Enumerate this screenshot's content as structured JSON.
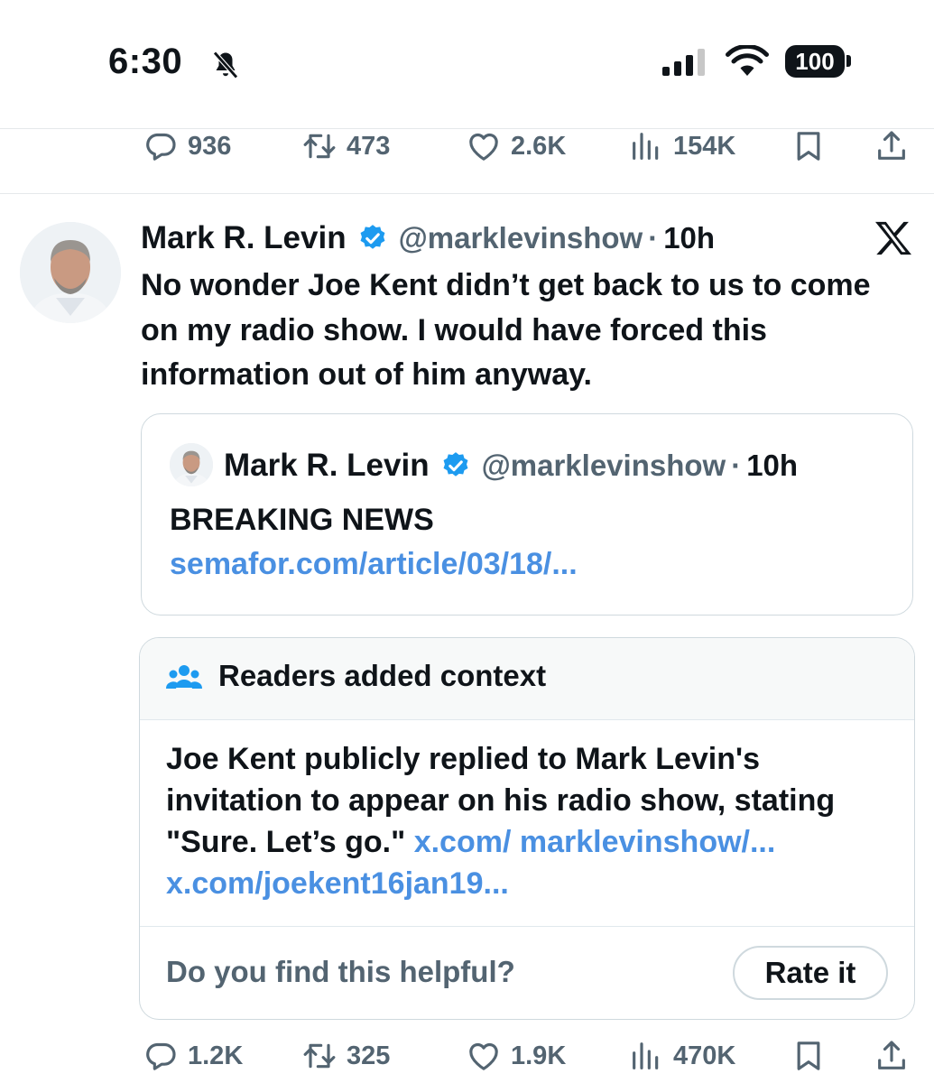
{
  "status_bar": {
    "time": "6:30",
    "battery": "100"
  },
  "prev_tweet_actions": {
    "replies": "936",
    "reposts": "473",
    "likes": "2.6K",
    "views": "154K"
  },
  "tweet": {
    "author_name": "Mark R. Levin",
    "handle": "@marklevinshow",
    "time_sep": "·",
    "age": "10h",
    "text": "No wonder Joe Kent didn’t get back to us to come on my radio show.  I would have forced this information out of him anyway."
  },
  "quoted_tweet": {
    "author_name": "Mark R. Levin",
    "handle": "@marklevinshow",
    "time_sep": "·",
    "age": "10h",
    "title": "BREAKING NEWS",
    "link": "semafor.com/article/03/18/..."
  },
  "community_note": {
    "title": "Readers added context",
    "text": "Joe Kent publicly replied to Mark Levin's invitation to appear on his radio show, stating \"Sure. Let’s go.\"",
    "link1_a": "x.com/",
    "link1_b": "marklevinshow/...",
    "link2": "x.com/joekent16jan19...",
    "question": "Do you find this helpful?",
    "rate_button": "Rate it"
  },
  "tweet_actions": {
    "replies": "1.2K",
    "reposts": "325",
    "likes": "1.9K",
    "views": "470K"
  },
  "colors": {
    "link": "#4a90e2",
    "verified": "#1d9bf0",
    "muted": "#536471",
    "text": "#0f1419"
  }
}
